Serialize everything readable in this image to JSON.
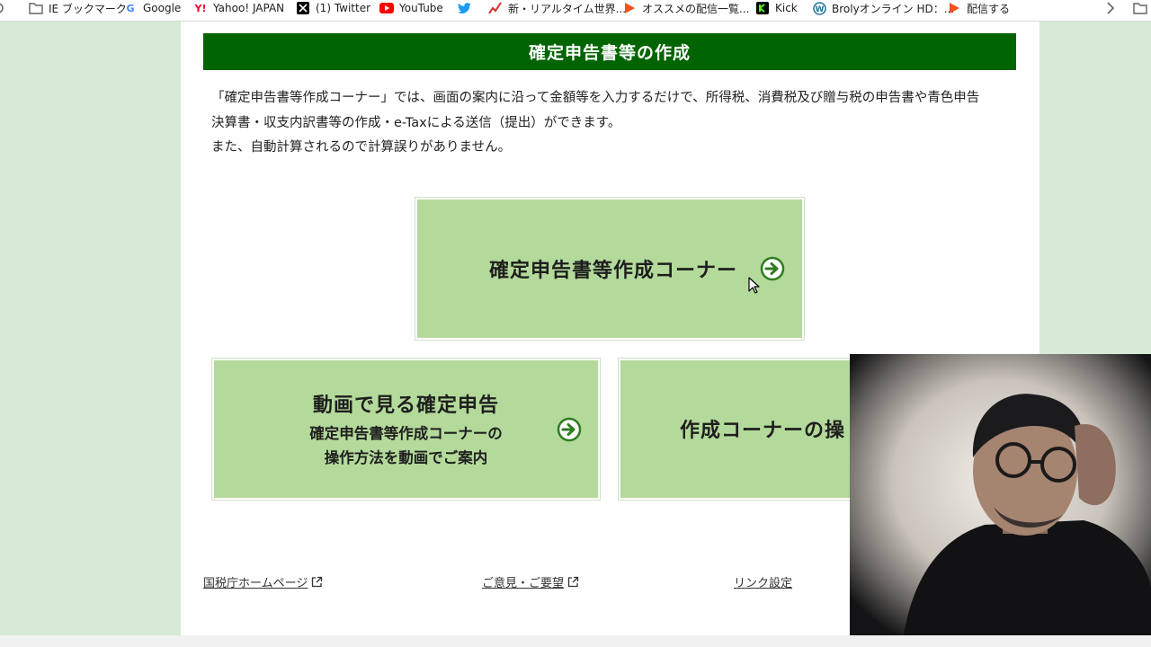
{
  "bookmarks": [
    {
      "label": "IE ブックマーク",
      "icon": "folder-icon"
    },
    {
      "label": "Google",
      "icon": "google-icon"
    },
    {
      "label": "Yahoo! JAPAN",
      "icon": "yahoo-icon"
    },
    {
      "label": "(1) Twitter",
      "icon": "x-icon"
    },
    {
      "label": "YouTube",
      "icon": "youtube-icon"
    },
    {
      "label": "",
      "icon": "twitter-bird-icon"
    },
    {
      "label": "新・リアルタイム世界...",
      "icon": "chart-icon"
    },
    {
      "label": "オススメの配信一覧...",
      "icon": "stream-icon"
    },
    {
      "label": "Kick",
      "icon": "kick-icon"
    },
    {
      "label": "Brolyオンライン HD：...",
      "icon": "wordpress-icon"
    },
    {
      "label": "配信する",
      "icon": "stream-icon"
    }
  ],
  "header": {
    "title": "確定申告書等の作成"
  },
  "intro": {
    "line1": "「確定申告書等作成コーナー」では、画面の案内に沿って金額等を入力するだけで、所得税、消費税及び贈与税の申告書や青色申告",
    "line2": "決算書・収支内訳書等の作成・e-Taxによる送信（提出）ができます。",
    "line3": "また、自動計算されるので計算誤りがありません。"
  },
  "cards": {
    "main": {
      "title": "確定申告書等作成コーナー"
    },
    "video": {
      "title": "動画で見る確定申告",
      "sub1": "確定申告書等作成コーナーの",
      "sub2": "操作方法を動画でご案内"
    },
    "ops": {
      "title": "作成コーナーの操"
    }
  },
  "footer": {
    "nta": "国税庁ホームページ",
    "feedback": "ご意見・ご要望",
    "links": "リンク設定"
  },
  "colors": {
    "header": "#006400",
    "card": "#b4da9b",
    "arrow": "#2e7d1f",
    "side": "#d7e9d7"
  }
}
